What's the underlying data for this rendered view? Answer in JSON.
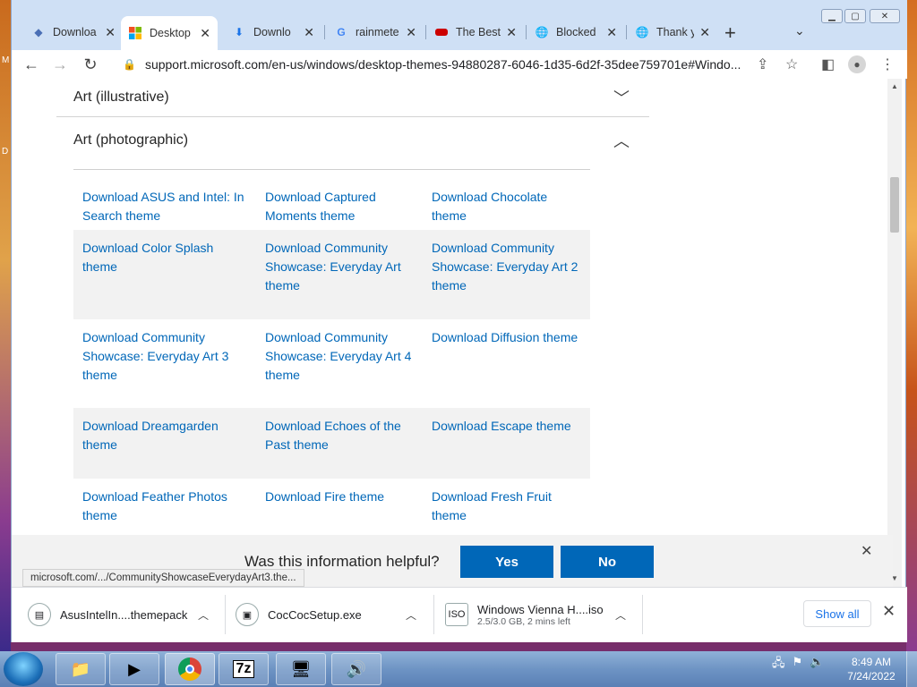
{
  "desktop_fragments": [
    "M",
    "D"
  ],
  "tabs": [
    {
      "title": "Downloa",
      "icon": "page-icon"
    },
    {
      "title": "Desktop",
      "icon": "microsoft-logo-icon"
    },
    {
      "title": "Downlo",
      "icon": "download-icon"
    },
    {
      "title": "rainmete",
      "icon": "google-icon"
    },
    {
      "title": "The Best",
      "icon": "site-icon"
    },
    {
      "title": "Blocked",
      "icon": "globe-icon"
    },
    {
      "title": "Thank y",
      "icon": "globe-icon"
    }
  ],
  "toolbar": {
    "url": "support.microsoft.com/en-us/windows/desktop-themes-94880287-6046-1d35-6d2f-35dee759701e#Windo..."
  },
  "accordion": {
    "illustrative": "Art (illustrative)",
    "photographic": "Art (photographic)"
  },
  "themes": [
    [
      "Download ASUS and Intel: In Search theme",
      "Download Captured Moments theme",
      "Download Chocolate theme"
    ],
    [
      "Download Color Splash theme",
      "Download Community Showcase: Everyday Art theme",
      "Download Community Showcase: Everyday Art 2 theme"
    ],
    [
      "Download Community Showcase: Everyday Art 3 theme",
      "Download Community Showcase: Everyday Art 4 theme",
      "Download Diffusion theme"
    ],
    [
      "Download Dreamgarden theme",
      "Download Echoes of the Past theme",
      "Download Escape theme"
    ],
    [
      "Download Feather Photos theme",
      "Download Fire theme",
      "Download Fresh Fruit theme"
    ]
  ],
  "feedback": {
    "question": "Was this information helpful?",
    "yes": "Yes",
    "no": "No"
  },
  "status_url": "microsoft.com/.../CommunityShowcaseEverydayArt3.the...",
  "downloads": [
    {
      "name": "AsusIntelIn....themepack"
    },
    {
      "name": "CocCocSetup.exe"
    },
    {
      "name": "Windows Vienna H....iso",
      "sub": "2.5/3.0 GB, 2 mins left"
    }
  ],
  "show_all": "Show all",
  "clock": {
    "time": "8:49 AM",
    "date": "7/24/2022"
  },
  "colors": {
    "link": "#0067b8",
    "button": "#0067b8",
    "tabstrip": "#cfe0f5"
  }
}
